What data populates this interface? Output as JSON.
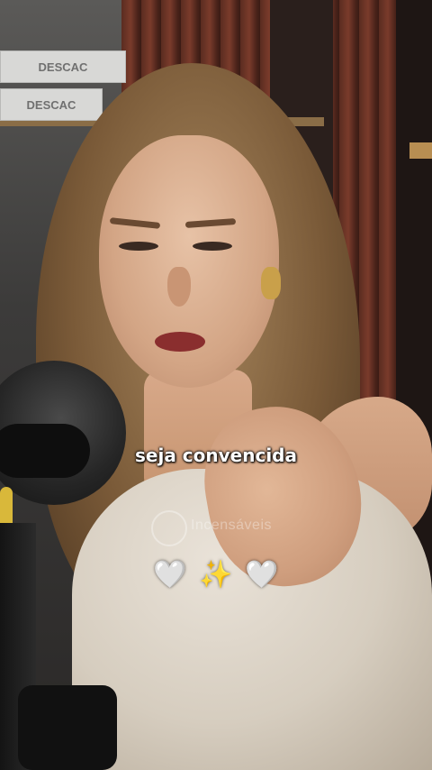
{
  "background": {
    "brand_signs": [
      "DESCAC",
      "DESCAC"
    ]
  },
  "caption": {
    "text": "seja convencida"
  },
  "watermark": {
    "text": "Incensáveis",
    "logo_icon": "circle-logo-icon"
  },
  "emoji_overlay": {
    "left_heart": "🤍",
    "sparkles": "✨",
    "right_heart": "🤍"
  },
  "colors": {
    "caption_text": "#ffffff",
    "slat_wall": "#7a3b2b",
    "microphone": "#262626",
    "mic_accent": "#d9b83a"
  }
}
